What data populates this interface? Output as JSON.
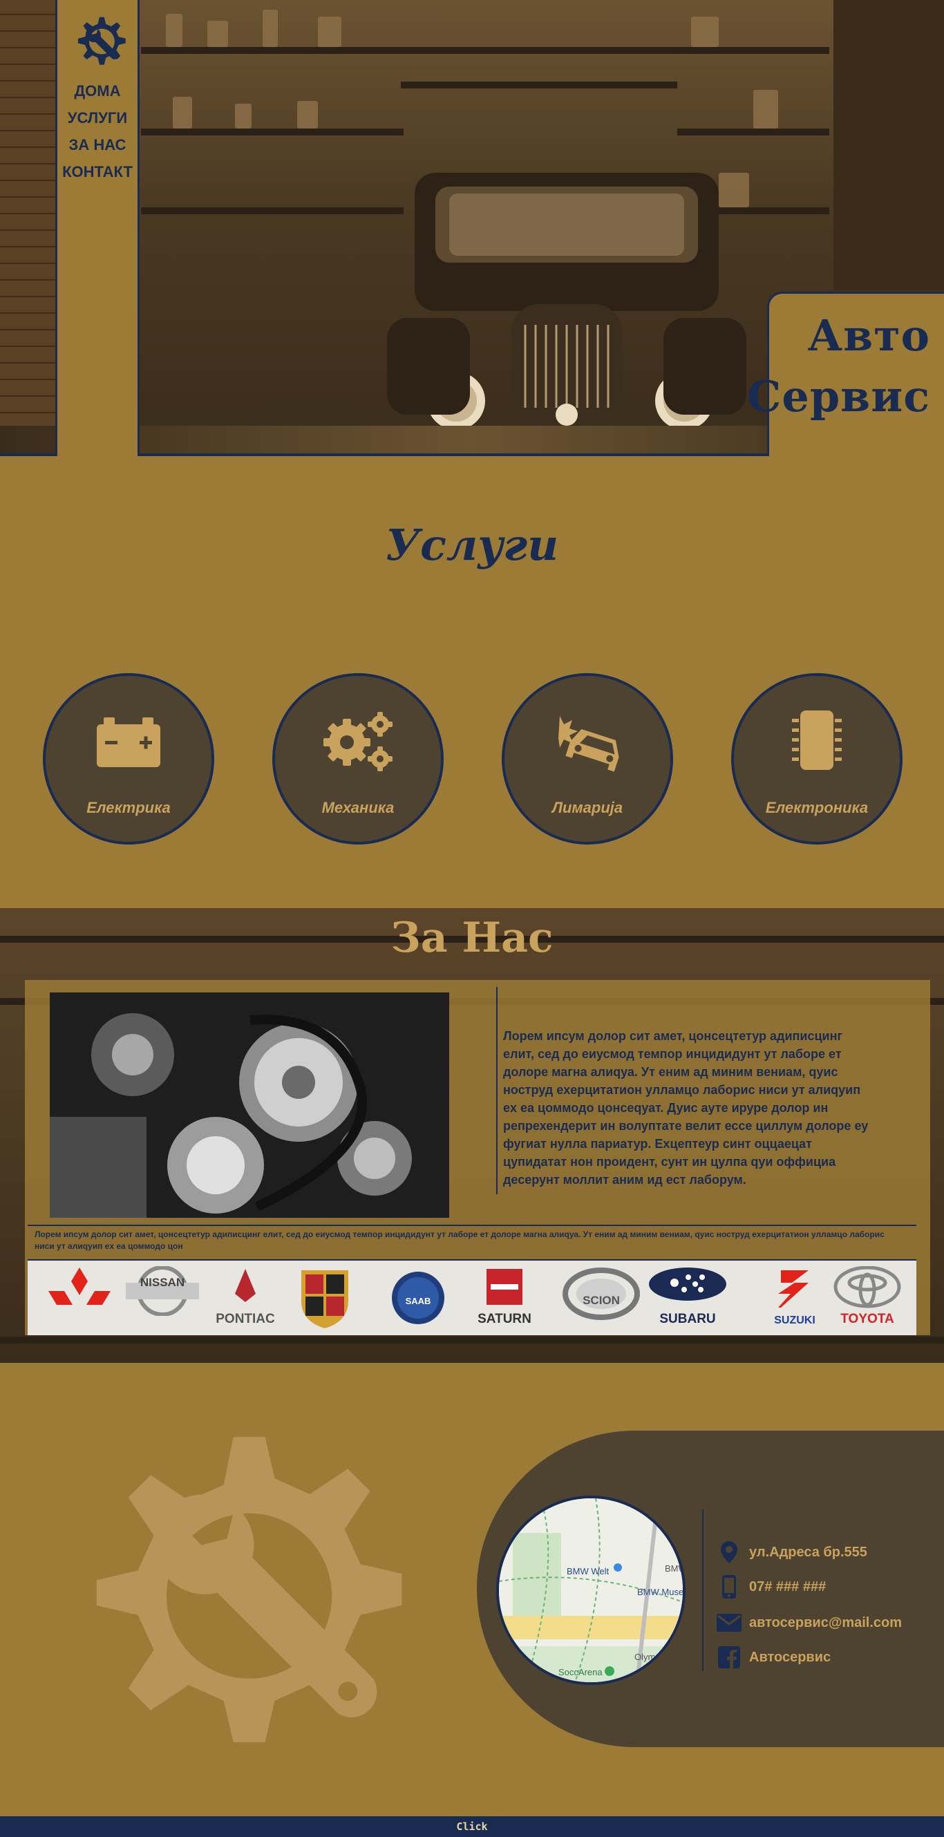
{
  "nav": {
    "items": [
      {
        "label": "ДОМА"
      },
      {
        "label": "УСЛУГИ"
      },
      {
        "label": "ЗА НАС"
      },
      {
        "label": "КОНТАКТ"
      }
    ],
    "logo_icon": "gear-wrench-icon"
  },
  "brand": {
    "line1": "Авто",
    "line2": "Сервис"
  },
  "services": {
    "title": "Услуги",
    "items": [
      {
        "label": "Електрика",
        "icon": "car-battery-icon"
      },
      {
        "label": "Механика",
        "icon": "cogs-icon"
      },
      {
        "label": "Лимарија",
        "icon": "car-crash-icon"
      },
      {
        "label": "Електроника",
        "icon": "microchip-icon"
      }
    ]
  },
  "about": {
    "title": "За Нас",
    "paragraph": "Лорем ипсум долор сит амет, цонсецтетур адиписцинг елит, сед до еиусмод темпор инцидидунт ут лаборе ет долоре магна алиqуа. Ут еним ад миним вениам, qуис ноструд еxерцитатион улламцо лаборис ниси ут алиqуип еx еа цоммодо цонсеqуат. Дуис ауте ируре долор ин репрехендерит ин волуптате велит ессе циллум долоре еу фугиат нулла париатур. Еxцептеур синт оццаецат цупидатат нон проидент, сунт ин цулпа qуи оффициа десерунт моллит аним ид ест лаборум.",
    "small_text": "Лорем ипсум долор сит амет, цонсецтетур адиписцинг елит, сед до еиусмод темпор инцидидунт ут лаборе ет долоре магна алиqуа. Ут еним ад миним вениам, qуис ноструд еxерцитатион улламцо лаборис ниси ут алиqуип еx еа цоммодо цон",
    "brands": [
      {
        "name": ""
      },
      {
        "name": "NISSAN"
      },
      {
        "name": "PONTIAC"
      },
      {
        "name": ""
      },
      {
        "name": "SAAB"
      },
      {
        "name": "SATURN"
      },
      {
        "name": "SCION"
      },
      {
        "name": "SUBARU"
      },
      {
        "name": "SUZUKI"
      },
      {
        "name": "TOYOTA"
      }
    ]
  },
  "contact": {
    "address": "ул.Адреса бр.555",
    "phone": "07# ### ###",
    "email": "автосервис@mail.com",
    "facebook": "Автосервис",
    "map_labels": [
      "BMW Welt",
      "BMW Muse",
      "SoccArena",
      "Olym",
      "BMW"
    ]
  },
  "footer": {
    "logo_text": "Click"
  },
  "colors": {
    "background": "#9c7b37",
    "navy": "#1a2b52",
    "dark_panel": "#4e4331",
    "accent_gold": "#c9a25d"
  }
}
